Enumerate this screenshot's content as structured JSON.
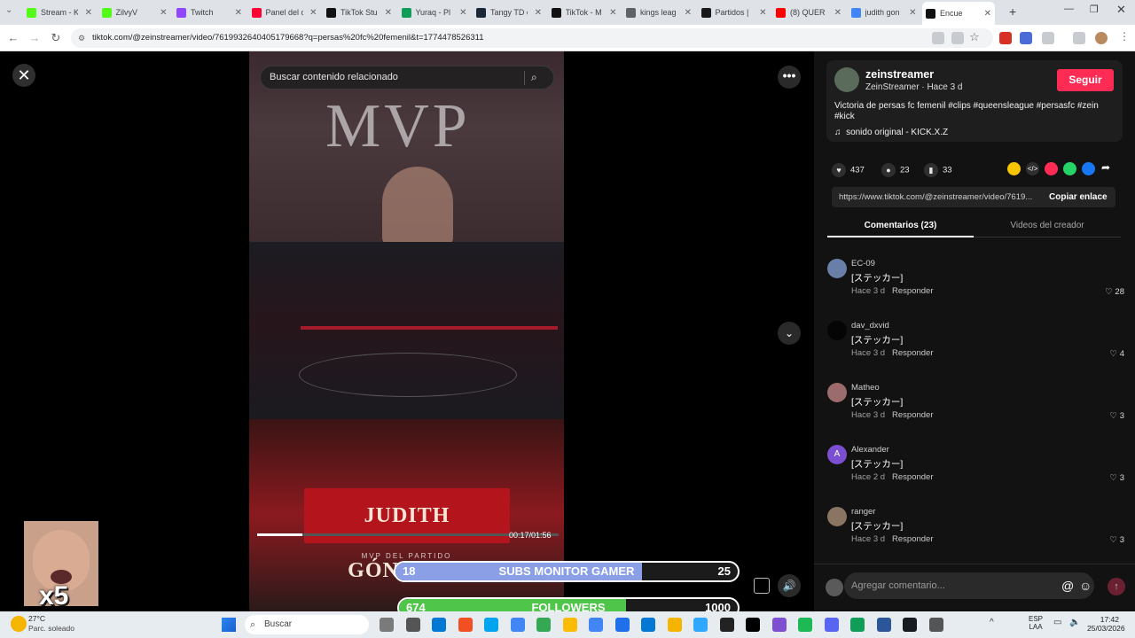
{
  "tabs": [
    {
      "label": "Stream - K",
      "color": "#53fc18"
    },
    {
      "label": "ZilvyV",
      "color": "#53fc18"
    },
    {
      "label": "Twitch",
      "color": "#9146ff"
    },
    {
      "label": "Panel del c",
      "color": "#ff0033"
    },
    {
      "label": "TikTok Stu",
      "color": "#111111"
    },
    {
      "label": "Yuraq - Pl",
      "color": "#0f9d58"
    },
    {
      "label": "Tangy TD o",
      "color": "#1b2838"
    },
    {
      "label": "TikTok - M",
      "color": "#111111"
    },
    {
      "label": "kings leag",
      "color": "#5f6368"
    },
    {
      "label": "Partidos |",
      "color": "#1a1a1a"
    },
    {
      "label": "(8) QUER",
      "color": "#ff0000"
    },
    {
      "label": "judith gon",
      "color": "#4285f4"
    },
    {
      "label": "Encue",
      "color": "#111111"
    }
  ],
  "browser": {
    "url": "tiktok.com/@zeinstreamer/video/7619932640405179668?q=persas%20fc%20femenil&t=1774478526311"
  },
  "viewer": {
    "search_placeholder": "Buscar contenido relacionado",
    "more_label": "•••",
    "video_text_top": "MVP",
    "video_text_name": "JUDITH GÓNGORA",
    "video_text_small": "MVP DEL PARTIDO",
    "time": "00:17/01:56",
    "progress": 0.15
  },
  "overlay": {
    "subs": {
      "left": "18",
      "label": "SUBS MONITOR GAMER",
      "right": "25",
      "fill": 0.72,
      "color": "#8a9fe6"
    },
    "followers": {
      "left": "674",
      "label": "FOLLOWERS",
      "right": "1000",
      "fill": 0.67,
      "color": "#4fc54a"
    },
    "multiplier": "x5"
  },
  "creator": {
    "handle": "zeinstreamer",
    "name_time": "ZeinStreamer · Hace 3 d",
    "follow_label": "Seguir",
    "caption": "Victoria de persas fc femenil #clips #queensleague #persasfc #zein #kick",
    "sound": "sonido original - KICK.X.Z",
    "likes": "437",
    "comments": "23",
    "saves": "33",
    "link": "https://www.tiktok.com/@zeinstreamer/video/7619...",
    "copy_label": "Copiar enlace"
  },
  "tabs_panel": {
    "comments_tab": "Comentarios (23)",
    "videos_tab": "Videos del creador"
  },
  "comments": [
    {
      "user": "EC-09",
      "text": "[ステッカー]",
      "time": "Hace 3 d",
      "reply": "Responder",
      "likes": "28",
      "avatar_color": "#6a7fa8"
    },
    {
      "user": "dav_dxvid",
      "text": "[ステッカー]",
      "time": "Hace 3 d",
      "reply": "Responder",
      "likes": "4",
      "avatar_color": "#050505"
    },
    {
      "user": "Matheo",
      "text": "[ステッカー]",
      "time": "Hace 3 d",
      "reply": "Responder",
      "likes": "3",
      "avatar_color": "#9c6b6b"
    },
    {
      "user": "Alexander",
      "text": "[ステッカー]",
      "time": "Hace 2 d",
      "reply": "Responder",
      "likes": "3",
      "avatar_color": "#7b4fd1",
      "initial": "A"
    },
    {
      "user": "ranger",
      "text": "[ステッカー]",
      "time": "Hace 3 d",
      "reply": "Responder",
      "likes": "3",
      "avatar_color": "#8a7563"
    }
  ],
  "comment_input_placeholder": "Agregar comentario...",
  "taskbar": {
    "weather_temp": "27°C",
    "weather_desc": "Parc. soleado",
    "search_label": "Buscar",
    "lang": "ESP",
    "lang2": "LAA",
    "time": "17:42",
    "date": "25/03/2026"
  }
}
